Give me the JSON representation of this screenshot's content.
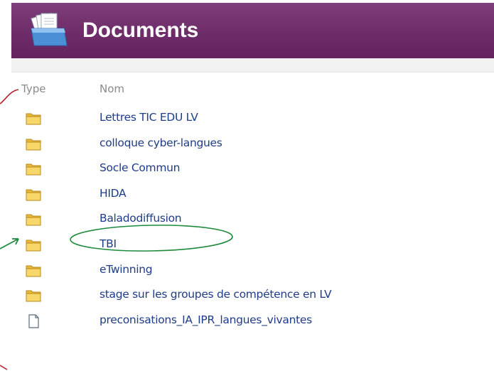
{
  "header": {
    "title": "Documents",
    "icon": "open-folder-documents-icon"
  },
  "columns": {
    "type": "Type",
    "name": "Nom"
  },
  "items": [
    {
      "name": "Lettres TIC EDU LV",
      "kind": "folder"
    },
    {
      "name": "colloque cyber-langues",
      "kind": "folder"
    },
    {
      "name": "Socle Commun",
      "kind": "folder"
    },
    {
      "name": "HIDA",
      "kind": "folder"
    },
    {
      "name": "Baladodiffusion",
      "kind": "folder"
    },
    {
      "name": "TBI",
      "kind": "folder"
    },
    {
      "name": "eTwinning",
      "kind": "folder"
    },
    {
      "name": "stage sur les groupes de compétence en LV",
      "kind": "folder"
    },
    {
      "name": "preconisations_IA_IPR_langues_vivantes",
      "kind": "file"
    }
  ],
  "colors": {
    "header": "#6e2c69",
    "link": "#1f3c88",
    "annotation_red": "#b0202a",
    "annotation_green": "#1e8a3c",
    "folder": "#f2c94c"
  }
}
